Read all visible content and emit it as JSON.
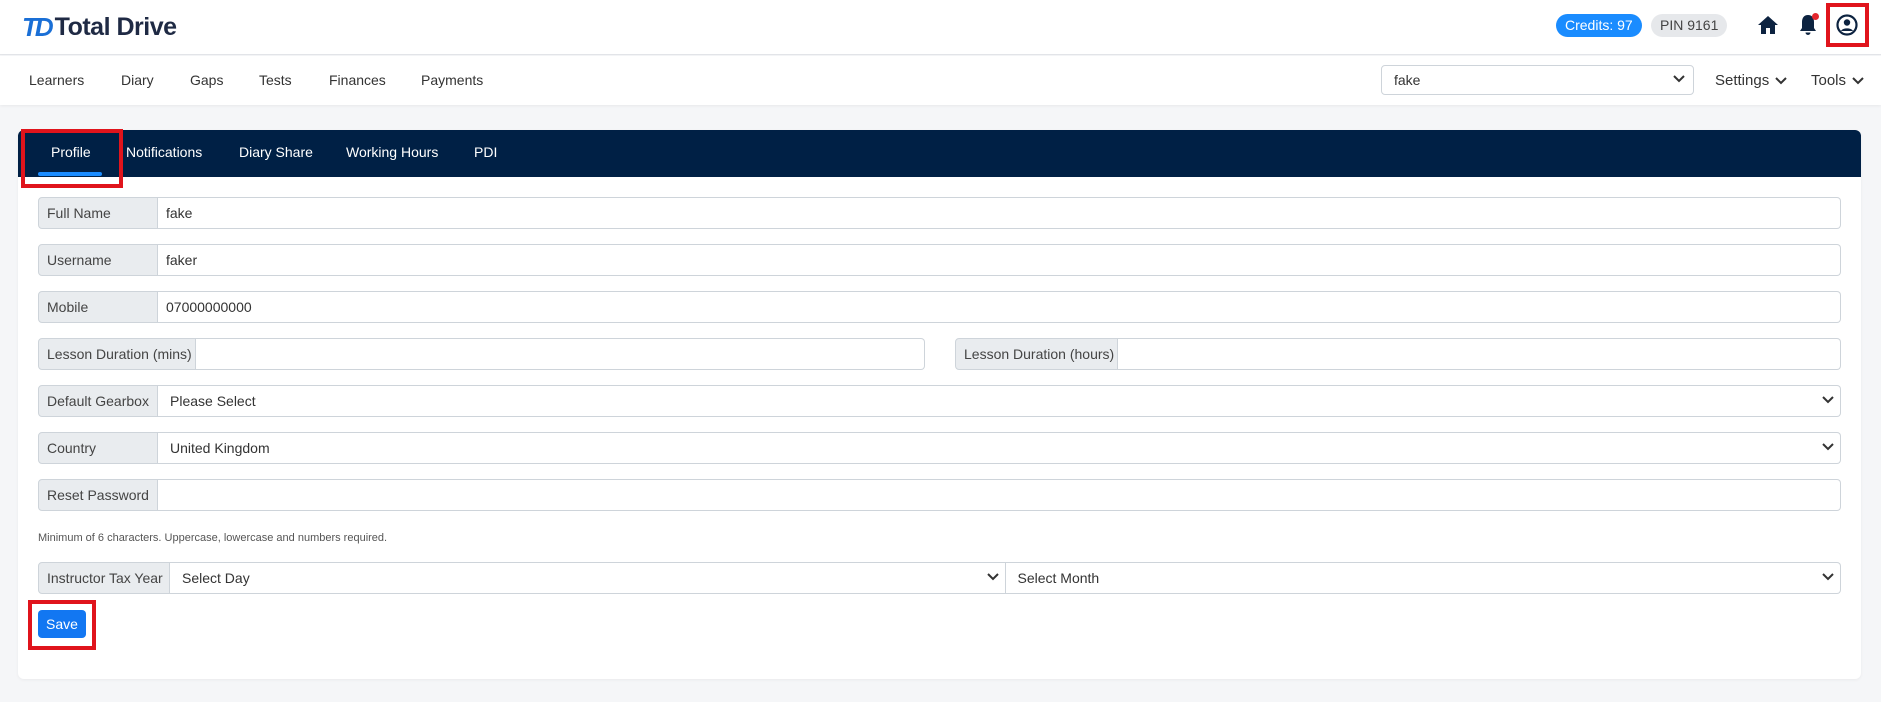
{
  "brand": {
    "mark": "TD",
    "name": "Total Drive"
  },
  "header": {
    "credits": "Credits: 97",
    "pin": "PIN 9161",
    "icons": [
      "home-icon",
      "bell-icon",
      "user-circle-icon"
    ]
  },
  "nav": {
    "items": [
      "Learners",
      "Diary",
      "Gaps",
      "Tests",
      "Finances",
      "Payments"
    ],
    "select_value": "fake",
    "settings": "Settings",
    "tools": "Tools"
  },
  "tabs": [
    "Profile",
    "Notifications",
    "Diary Share",
    "Working Hours",
    "PDI"
  ],
  "form": {
    "full_name_label": "Full Name",
    "full_name": "fake",
    "username_label": "Username",
    "username": "faker",
    "mobile_label": "Mobile",
    "mobile": "07000000000",
    "lesson_mins_label": "Lesson Duration (mins)",
    "lesson_mins": "",
    "lesson_hours_label": "Lesson Duration (hours)",
    "lesson_hours": "",
    "gearbox_label": "Default Gearbox",
    "gearbox": "Please Select",
    "country_label": "Country",
    "country": "United Kingdom",
    "reset_label": "Reset Password",
    "reset": "",
    "help": "Minimum of 6 characters. Uppercase, lowercase and numbers required.",
    "tax_label": "Instructor Tax Year",
    "tax_day": "Select Day",
    "tax_month": "Select Month",
    "save": "Save"
  },
  "colors": {
    "accent": "#1a8cff",
    "tabbar": "#002045",
    "highlight": "#e0141c",
    "save": "#1277f2"
  }
}
